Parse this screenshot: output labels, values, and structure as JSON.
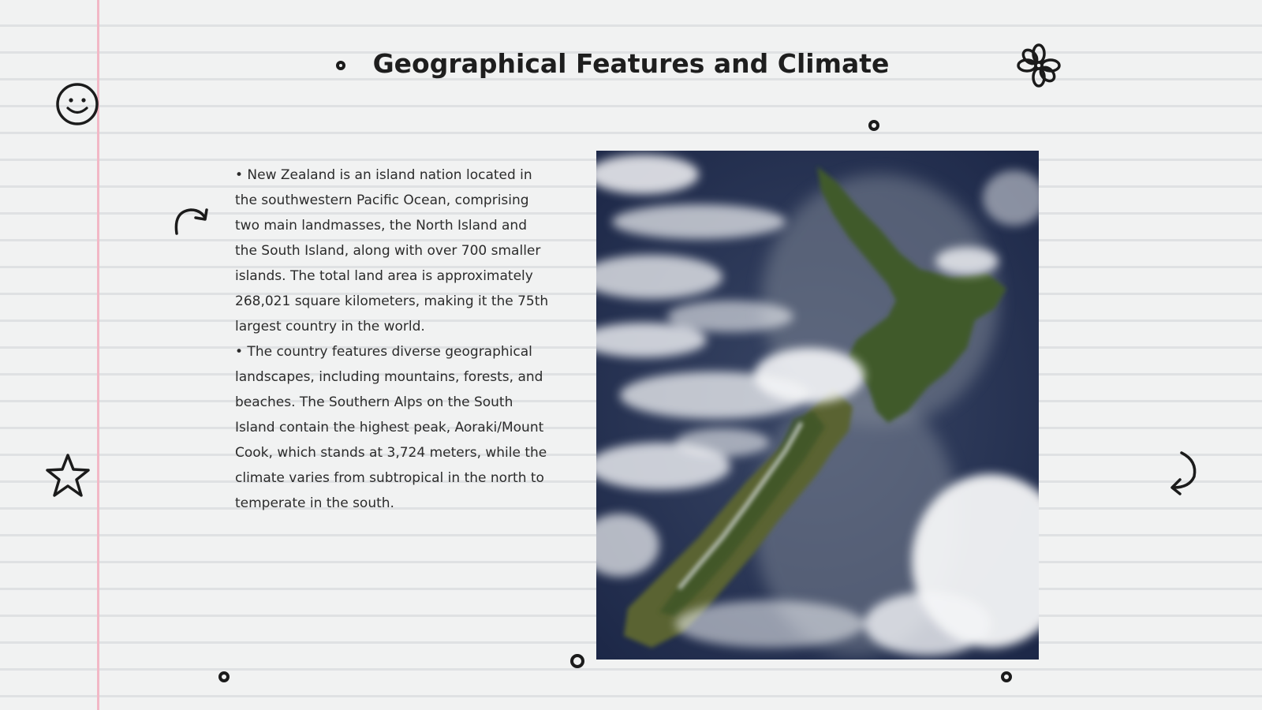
{
  "slide": {
    "title": "Geographical Features and Climate",
    "bullets": [
      "• New Zealand is an island nation located in the southwestern Pacific Ocean, comprising two main landmasses, the North Island and the South Island, along with over 700 smaller islands. The total land area is approximately 268,021 square kilometers, making it the 75th largest country in the world.",
      "• The country features diverse geographical landscapes, including mountains, forests, and beaches. The Southern Alps on the South Island contain the highest peak, Aoraki/Mount Cook, which stands at 3,724 meters, while the climate varies from subtropical in the north to temperate in the south."
    ]
  },
  "doodles": [
    "smiley-icon",
    "star-icon",
    "flower-icon",
    "curved-arrow-right-icon",
    "curved-arrow-down-left-icon"
  ],
  "image": {
    "subject": "satellite-photo-new-zealand"
  },
  "colors": {
    "background": "#f1f2f2",
    "rule_line": "#dfe1e3",
    "margin_line": "#f2b8c6",
    "ink": "#1b1b1b"
  }
}
